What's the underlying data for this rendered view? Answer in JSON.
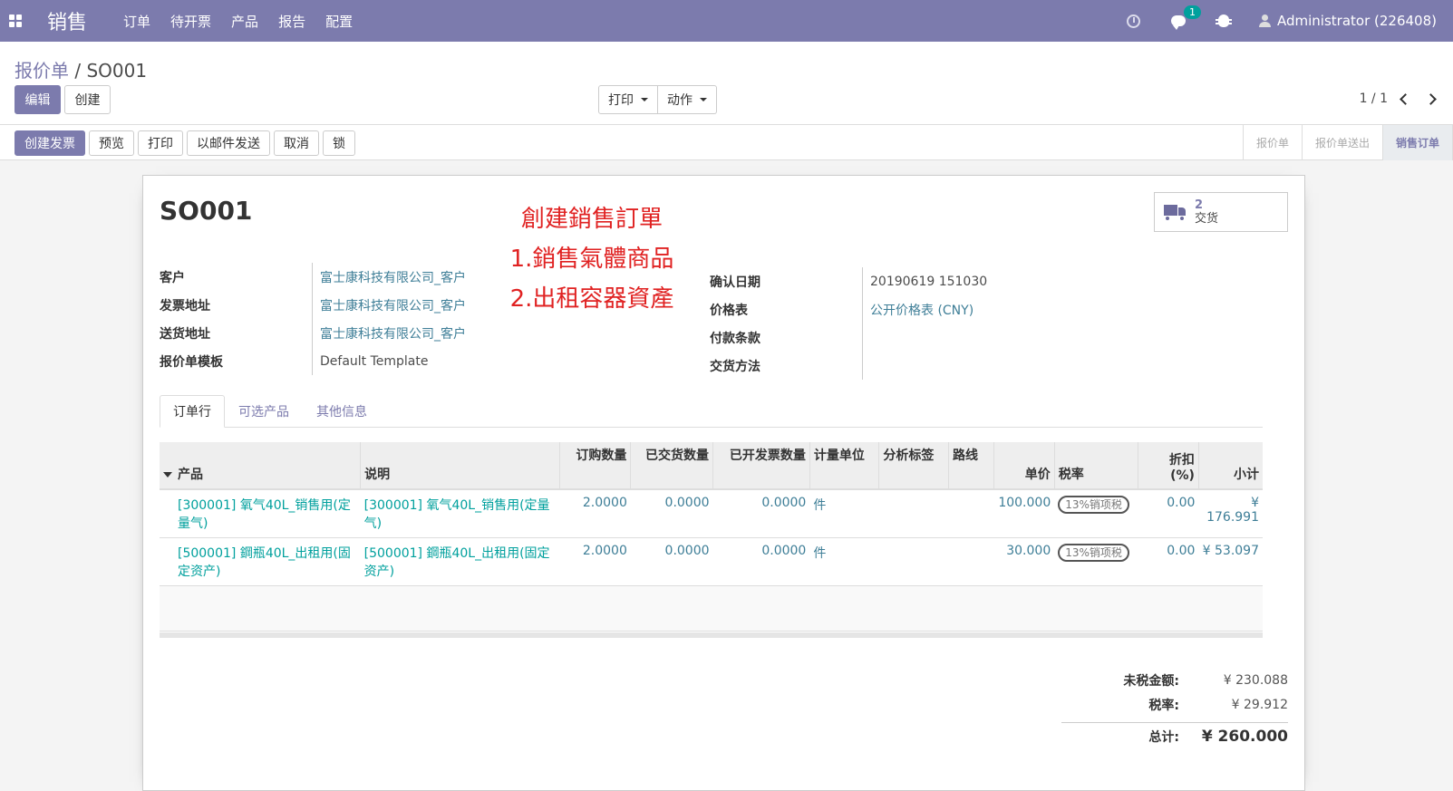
{
  "navbar": {
    "brand": "销售",
    "menus": [
      "订单",
      "待开票",
      "产品",
      "报告",
      "配置"
    ],
    "notification_count": "1",
    "user": "Administrator (226408)"
  },
  "control_panel": {
    "breadcrumb_parent": "报价单",
    "breadcrumb_sep": " / ",
    "breadcrumb_current": "SO001",
    "edit_label": "编辑",
    "create_label": "创建",
    "print_label": "打印",
    "action_label": "动作",
    "pager": "1 / 1"
  },
  "statusbar": {
    "buttons": [
      "创建发票",
      "预览",
      "打印",
      "以邮件发送",
      "取消",
      "锁"
    ],
    "stages": [
      "报价单",
      "报价单送出",
      "销售订单"
    ],
    "active_stage": "销售订单"
  },
  "sheet": {
    "title": "SO001",
    "annotation": [
      "創建銷售訂單",
      "1.銷售氣體商品",
      "2.出租容器資產"
    ],
    "smart_button": {
      "count": "2",
      "label": "交货",
      "icon": "truck-icon"
    },
    "left_fields": [
      {
        "label": "客户",
        "value": "富士康科技有限公司_客户",
        "link": true
      },
      {
        "label": "发票地址",
        "value": "富士康科技有限公司_客户",
        "link": true
      },
      {
        "label": "送货地址",
        "value": "富士康科技有限公司_客户",
        "link": true
      },
      {
        "label": "报价单模板",
        "value": "Default Template",
        "link": false
      }
    ],
    "right_fields": [
      {
        "label": "确认日期",
        "value": "20190619 151030",
        "link": false
      },
      {
        "label": "价格表",
        "value": "公开价格表 (CNY)",
        "link": true
      },
      {
        "label": "付款条款",
        "value": "",
        "link": false
      },
      {
        "label": "交货方法",
        "value": "",
        "link": false
      }
    ],
    "tabs": [
      "订单行",
      "可选产品",
      "其他信息"
    ],
    "table": {
      "headers": [
        "产品",
        "说明",
        "订购数量",
        "已交货数量",
        "已开发票数量",
        "计量单位",
        "分析标签",
        "路线",
        "单价",
        "税率",
        "折扣 (%)",
        "小计"
      ],
      "rows": [
        {
          "product": "[300001] 氧气40L_销售用(定量气)",
          "description": "[300001] 氧气40L_销售用(定量气)",
          "qty": "2.0000",
          "delivered": "0.0000",
          "invoiced": "0.0000",
          "uom": "件",
          "analytic": "",
          "route": "",
          "price": "100.000",
          "tax": "13%销项税",
          "discount": "0.00",
          "subtotal": "¥ 176.991"
        },
        {
          "product": "[500001] 鋼瓶40L_出租用(固定资产)",
          "description": "[500001] 鋼瓶40L_出租用(固定资产)",
          "qty": "2.0000",
          "delivered": "0.0000",
          "invoiced": "0.0000",
          "uom": "件",
          "analytic": "",
          "route": "",
          "price": "30.000",
          "tax": "13%销项税",
          "discount": "0.00",
          "subtotal": "¥ 53.097"
        }
      ]
    },
    "totals": {
      "untaxed_label": "未税金额:",
      "untaxed": "¥ 230.088",
      "tax_label": "税率:",
      "tax": "¥ 29.912",
      "total_label": "总计:",
      "total": "¥ 260.000"
    }
  },
  "colors": {
    "brand": "#7c7bad",
    "link": "#3e7e97",
    "teal": "#00a09d",
    "annotation": "#e02222"
  }
}
